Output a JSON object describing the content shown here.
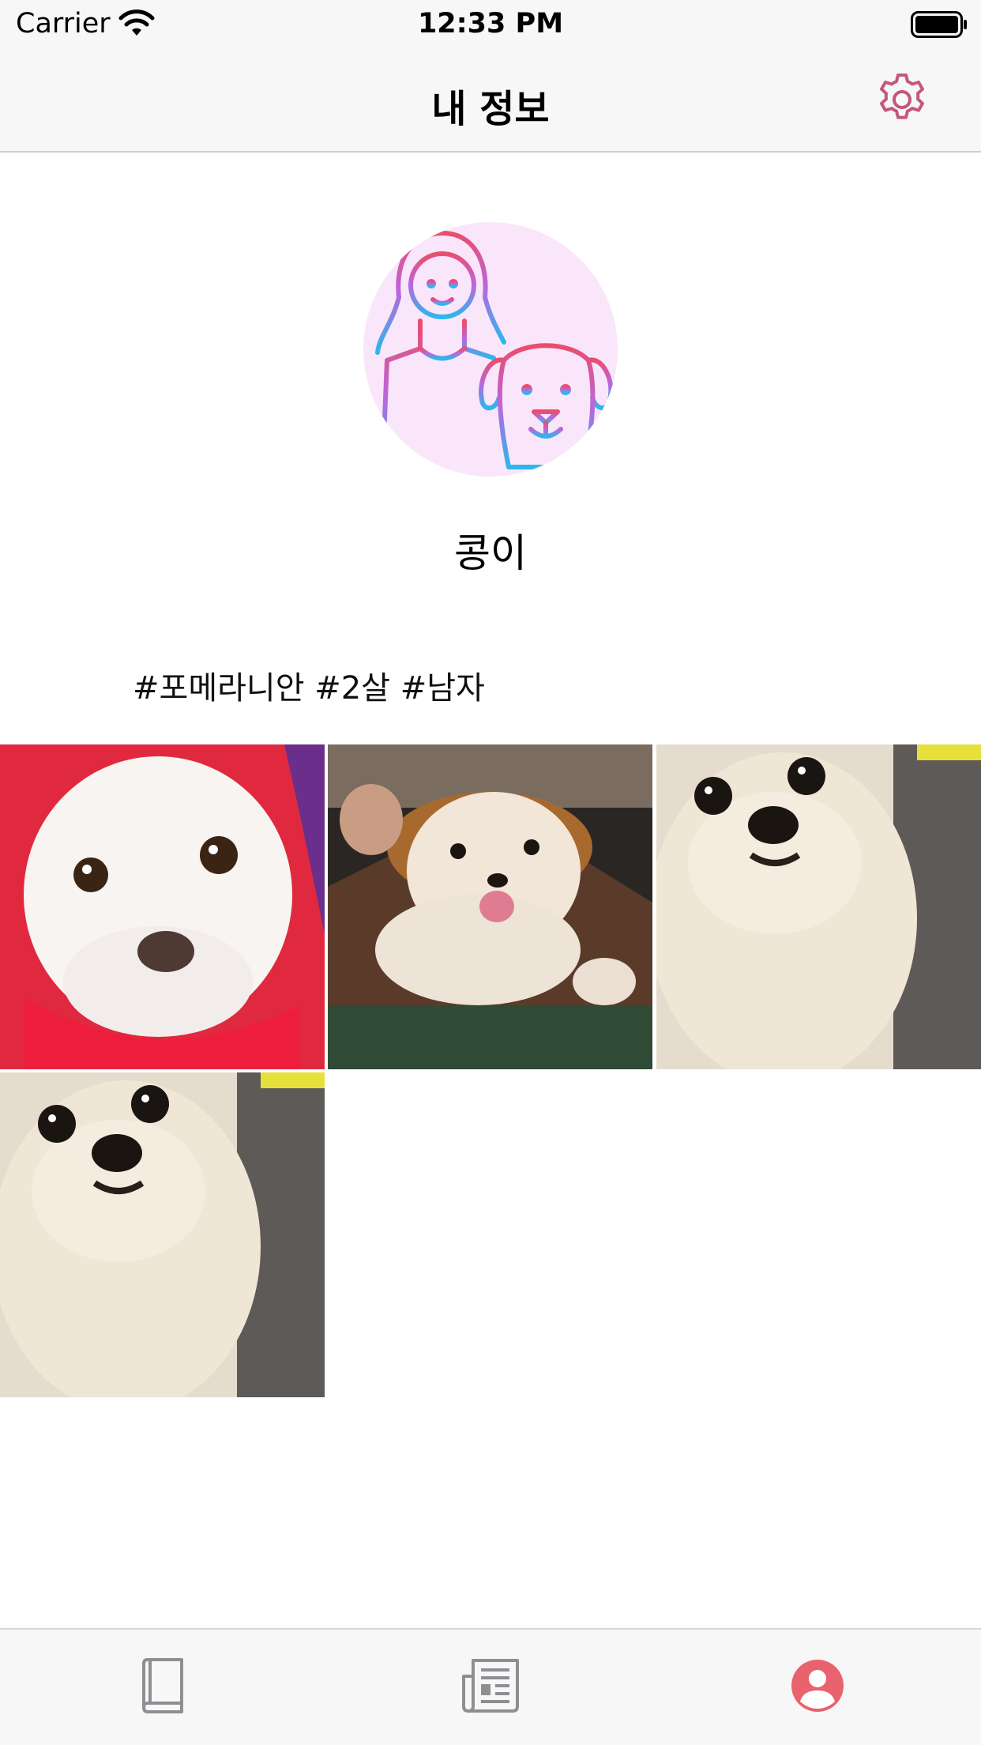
{
  "status_bar": {
    "carrier": "Carrier",
    "time": "12:33 PM",
    "icons": [
      "wifi-icon",
      "battery-icon"
    ]
  },
  "nav": {
    "title": "내 정보",
    "settings_icon": "gear-icon"
  },
  "profile": {
    "name": "콩이",
    "tags": "#포메라니안 #2살 #남자",
    "avatar_icon": "girl-with-dog-icon"
  },
  "photos": [
    {
      "name": "photo-pomeranian-red-hoodie"
    },
    {
      "name": "photo-pomeranian-brown-costume"
    },
    {
      "name": "photo-pomeranian-closeup"
    },
    {
      "name": "photo-pomeranian-closeup-2"
    }
  ],
  "tab_bar": {
    "tabs": [
      {
        "icon": "book-icon",
        "active": false
      },
      {
        "icon": "newspaper-icon",
        "active": false
      },
      {
        "icon": "profile-icon",
        "active": true
      }
    ]
  },
  "colors": {
    "accent": "#e8636e",
    "settings": "#c5577b",
    "inactive_tab": "#8e8e93",
    "avatar_bg": "#fae6fb"
  }
}
